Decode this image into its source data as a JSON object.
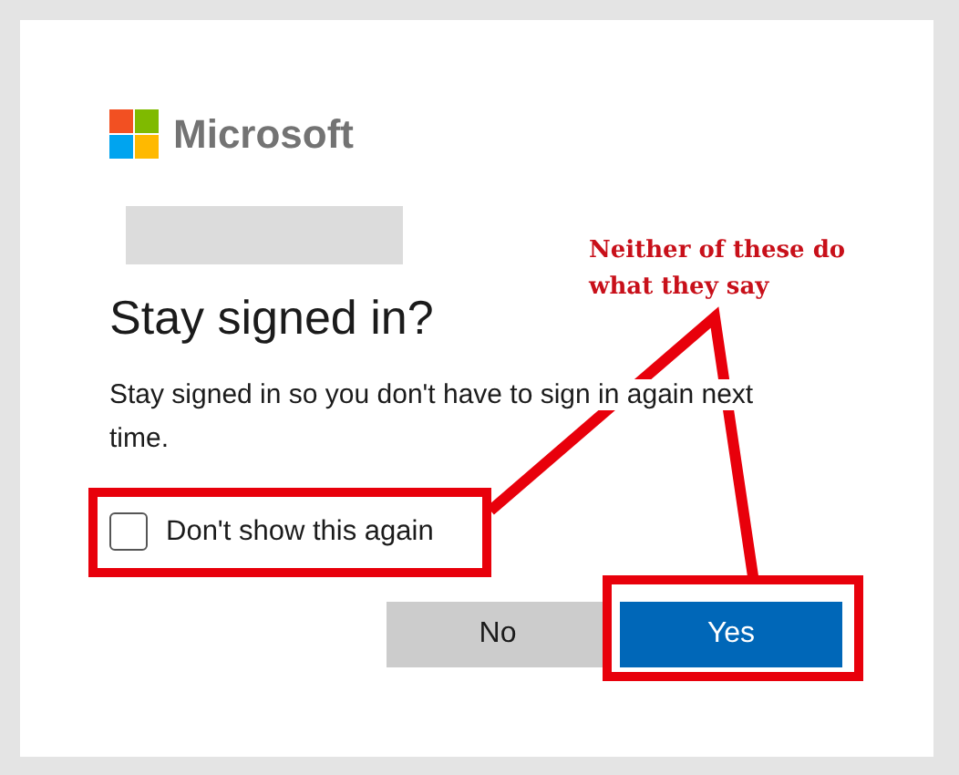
{
  "brand": {
    "name": "Microsoft"
  },
  "dialog": {
    "title": "Stay signed in?",
    "message": "Stay signed in so you don't have to sign in again next time.",
    "checkbox": {
      "label": "Don't show this again",
      "checked": false
    },
    "buttons": [
      {
        "label": "No",
        "kind": "secondary"
      },
      {
        "label": "Yes",
        "kind": "primary"
      }
    ]
  },
  "annotation": {
    "text": "Neither of these do what they say"
  }
}
